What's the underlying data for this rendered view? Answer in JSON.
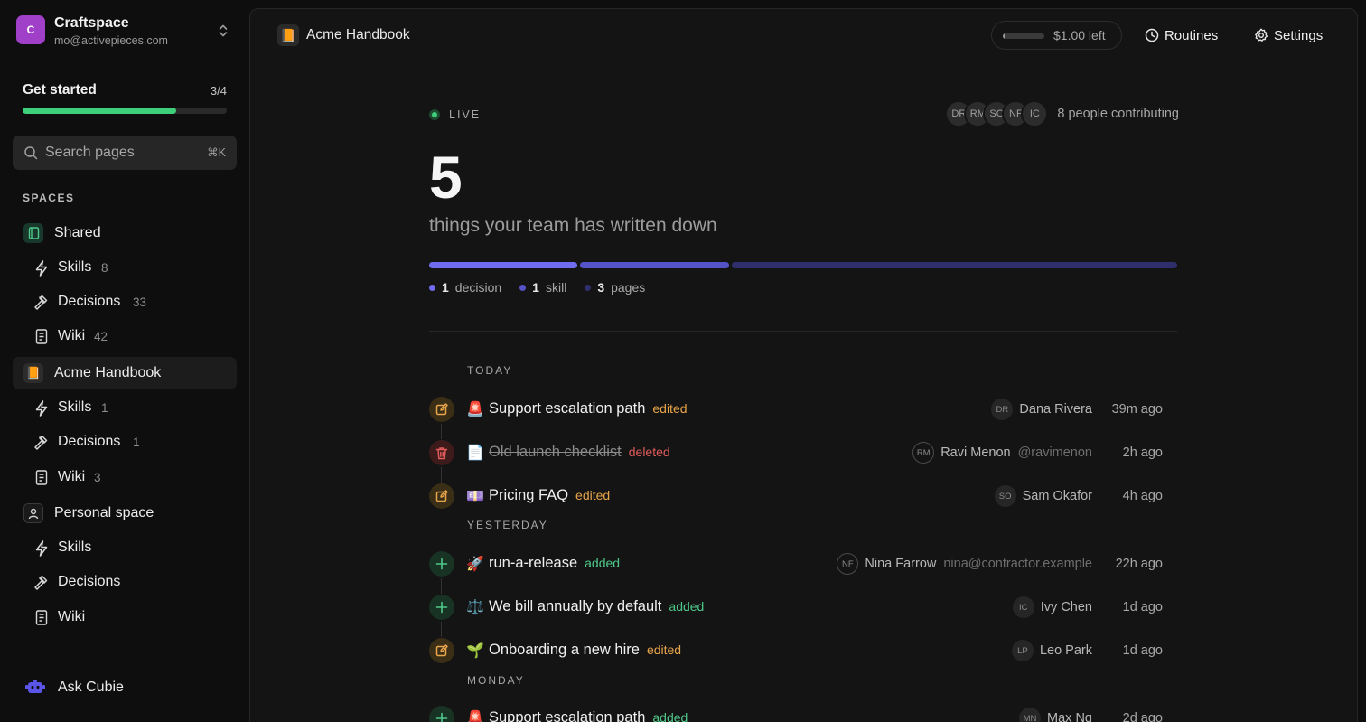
{
  "workspace": {
    "initial": "C",
    "name": "Craftspace",
    "email": "mo@activepieces.com"
  },
  "get_started": {
    "title": "Get started",
    "count": "3/4",
    "progress": 0.75
  },
  "search": {
    "placeholder": "Search pages",
    "shortcut": "⌘K"
  },
  "spaces_label": "SPACES",
  "sidebar": {
    "shared": {
      "label": "Shared",
      "icon": "book-icon"
    },
    "shared_items": [
      {
        "label": "Skills",
        "count": "8",
        "icon": "bolt-icon"
      },
      {
        "label": "Decisions",
        "count": "33",
        "icon": "gavel-icon"
      },
      {
        "label": "Wiki",
        "count": "42",
        "icon": "document-icon"
      }
    ],
    "handbook": {
      "label": "Acme Handbook",
      "emoji": "📙"
    },
    "handbook_items": [
      {
        "label": "Skills",
        "count": "1",
        "icon": "bolt-icon"
      },
      {
        "label": "Decisions",
        "count": "1",
        "icon": "gavel-icon"
      },
      {
        "label": "Wiki",
        "count": "3",
        "icon": "document-icon"
      }
    ],
    "personal": {
      "label": "Personal space",
      "icon": "person-icon"
    },
    "personal_items": [
      {
        "label": "Skills",
        "icon": "bolt-icon"
      },
      {
        "label": "Decisions",
        "icon": "gavel-icon"
      },
      {
        "label": "Wiki",
        "icon": "document-icon"
      }
    ],
    "ask": {
      "label": "Ask Cubie",
      "icon": "cubie-icon"
    }
  },
  "topbar": {
    "crumb_emoji": "📙",
    "crumb_title": "Acme Handbook",
    "credits_text": "$1.00 left",
    "credits_fraction": 0.05,
    "routines_label": "Routines",
    "settings_label": "Settings"
  },
  "status": {
    "live_label": "LIVE",
    "contributors": [
      "DR",
      "RM",
      "SO",
      "NF",
      "IC"
    ],
    "contributors_text": "8 people contributing"
  },
  "summary": {
    "count": "5",
    "subtitle": "things your team has written down",
    "segments": [
      {
        "label": "decision",
        "count": "1",
        "value": 1,
        "color": "#6f6cf0"
      },
      {
        "label": "skill",
        "count": "1",
        "value": 1,
        "color": "#5553c8"
      },
      {
        "label": "pages",
        "count": "3",
        "value": 3,
        "color": "#2f2f6e"
      }
    ]
  },
  "activity": {
    "groups": [
      "TODAY",
      "YESTERDAY",
      "MONDAY"
    ],
    "rows": [
      {
        "kind": "edit",
        "emoji": "🚨",
        "title": "Support escalation path",
        "action": "edited",
        "initials": "DR",
        "name": "Dana Rivera",
        "handle": "",
        "time": "39m ago"
      },
      {
        "kind": "del",
        "emoji": "📄",
        "title": "Old launch checklist",
        "action": "deleted",
        "initials": "RM",
        "name": "Ravi Menon",
        "handle": "@ravimenon",
        "time": "2h ago"
      },
      {
        "kind": "edit",
        "emoji": "💷",
        "title": "Pricing FAQ",
        "action": "edited",
        "initials": "SO",
        "name": "Sam Okafor",
        "handle": "",
        "time": "4h ago"
      },
      {
        "kind": "add",
        "emoji": "🚀",
        "title": "run-a-release",
        "action": "added",
        "initials": "NF",
        "name": "Nina Farrow",
        "handle": "nina@contractor.example",
        "time": "22h ago"
      },
      {
        "kind": "add",
        "emoji": "⚖️",
        "title": "We bill annually by default",
        "action": "added",
        "initials": "IC",
        "name": "Ivy Chen",
        "handle": "",
        "time": "1d ago"
      },
      {
        "kind": "edit",
        "emoji": "🌱",
        "title": "Onboarding a new hire",
        "action": "edited",
        "initials": "LP",
        "name": "Leo Park",
        "handle": "",
        "time": "1d ago"
      },
      {
        "kind": "add",
        "emoji": "🚨",
        "title": "Support escalation path",
        "action": "added",
        "initials": "MN",
        "name": "Max Ng",
        "handle": "",
        "time": "2d ago"
      }
    ]
  }
}
